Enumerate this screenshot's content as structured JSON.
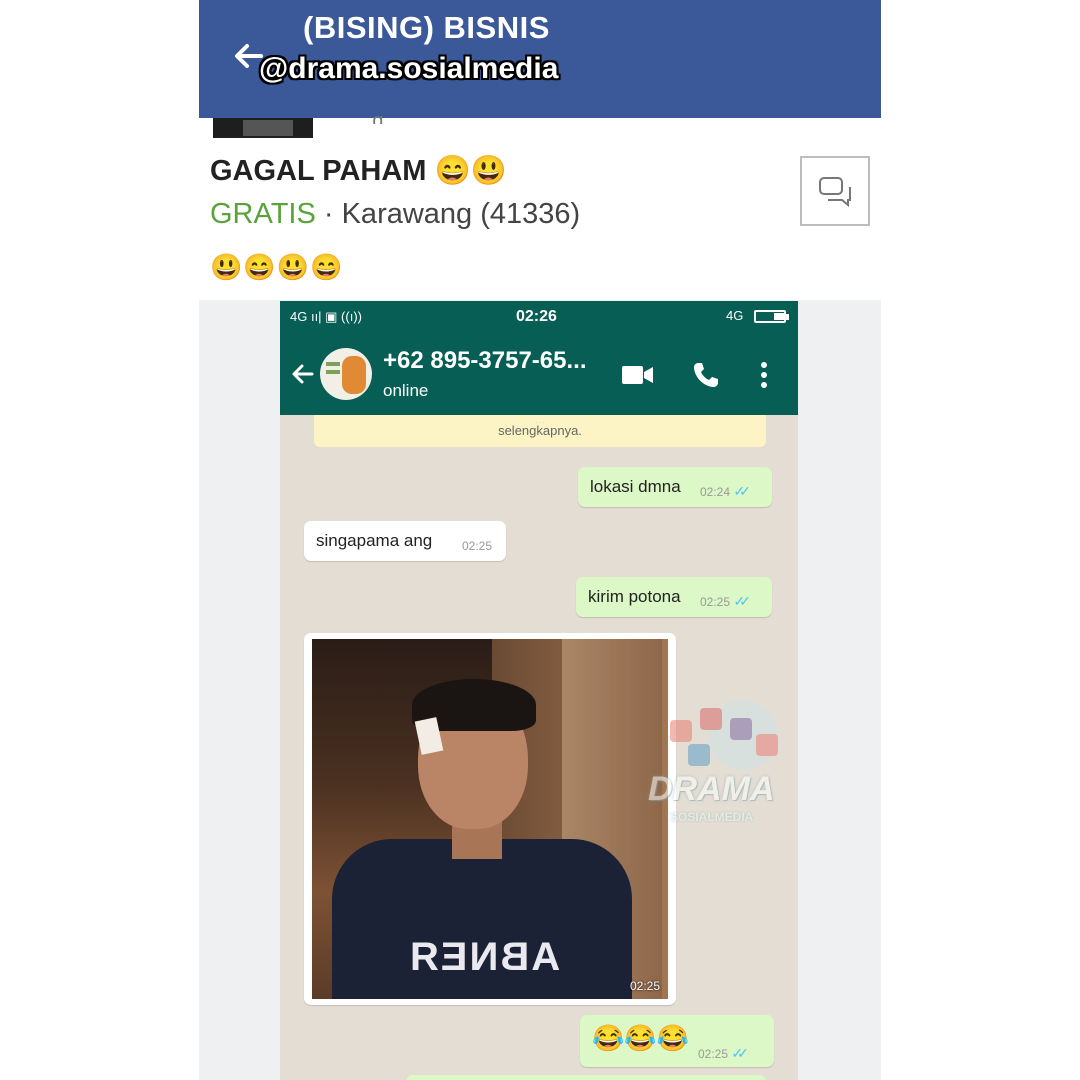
{
  "fb": {
    "title": "(BISING) BISNIS",
    "watermark": "@drama.sosialmedia"
  },
  "post": {
    "cut_text": ", , ,  g",
    "title": "GAGAL PAHAM 😄😃",
    "price": "GRATIS",
    "separator": " · ",
    "location": "Karawang (41336)",
    "body": "😃😄😃😄"
  },
  "wa": {
    "status_left": "4G ıı|  ▣  ((ı))",
    "time": "02:26",
    "network": "4G",
    "contact": "+62 895-3757-65...",
    "presence": "online",
    "system_notice_cut": "…",
    "system_notice": "selengkapnya.",
    "messages": [
      {
        "dir": "out",
        "text": "lokasi dmna",
        "time": "02:24"
      },
      {
        "dir": "in",
        "text": "singapama ang",
        "time": "02:25"
      },
      {
        "dir": "out",
        "text": "kirim potona",
        "time": "02:25"
      },
      {
        "dir": "in",
        "type": "image",
        "time": "02:25",
        "shirt_print": "ABNEЯ"
      },
      {
        "dir": "out",
        "text": "😂😂😂",
        "time": "02:25"
      }
    ]
  },
  "watermark_logo": {
    "word": "DRAMA",
    "sub": "SOSIALMEDIA"
  },
  "colors": {
    "fb_blue": "#3b5998",
    "wa_green": "#075e54",
    "out_bubble": "#dcf8c6",
    "price_green": "#5aa33b",
    "tick_blue": "#4fc3f7"
  },
  "icons": [
    "back-arrow-icon",
    "message-icon",
    "video-call-icon",
    "phone-icon",
    "more-vert-icon"
  ]
}
